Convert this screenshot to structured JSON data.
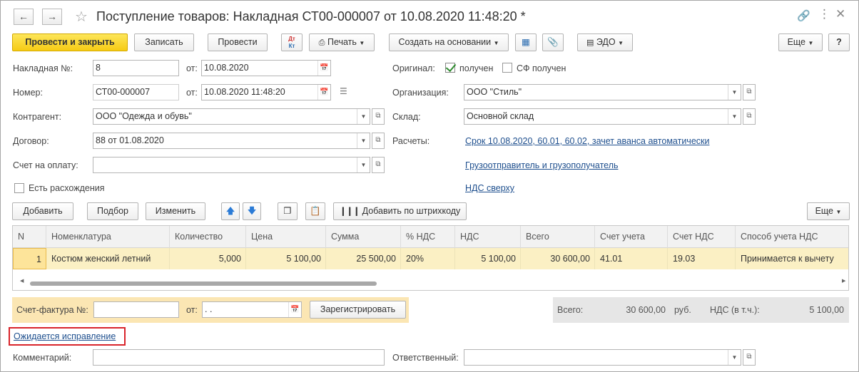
{
  "window": {
    "title": "Поступление товаров: Накладная СТ00-000007 от 10.08.2020 11:48:20 *"
  },
  "toolbar": {
    "post_close": "Провести и закрыть",
    "save": "Записать",
    "post": "Провести",
    "dtkt": "Дт Кт",
    "print": "Печать",
    "create_based": "Создать на основании",
    "edo": "ЭДО",
    "more": "Еще",
    "help": "?"
  },
  "form": {
    "invoice_label": "Накладная №:",
    "invoice_value": "8",
    "from_label": "от:",
    "invoice_date": "10.08.2020",
    "number_label": "Номер:",
    "number_value": "СТ00-000007",
    "number_date": "10.08.2020 11:48:20",
    "counterparty_label": "Контрагент:",
    "counterparty_value": "ООО \"Одежда и обувь\"",
    "contract_label": "Договор:",
    "contract_value": "88 от 01.08.2020",
    "payment_label": "Счет на оплату:",
    "payment_value": "",
    "discrepancy_label": "Есть расхождения",
    "original_label": "Оригинал:",
    "received_label": "получен",
    "sf_received_label": "СФ получен",
    "organization_label": "Организация:",
    "organization_value": "ООО \"Стиль\"",
    "warehouse_label": "Склад:",
    "warehouse_value": "Основной склад",
    "settlements_label": "Расчеты:",
    "settlements_link": "Срок 10.08.2020, 60.01, 60.02, зачет аванса автоматически",
    "shipper_link": "Грузоотправитель и грузополучатель",
    "vat_link": "НДС сверху"
  },
  "table_toolbar": {
    "add": "Добавить",
    "select": "Подбор",
    "edit": "Изменить",
    "barcode": "Добавить по штрихкоду",
    "more": "Еще"
  },
  "table": {
    "columns": [
      "N",
      "Номенклатура",
      "Количество",
      "Цена",
      "Сумма",
      "% НДС",
      "НДС",
      "Всего",
      "Счет учета",
      "Счет НДС",
      "Способ учета НДС"
    ],
    "rows": [
      [
        "1",
        "Костюм женский летний",
        "5,000",
        "5 100,00",
        "25 500,00",
        "20%",
        "5 100,00",
        "30 600,00",
        "41.01",
        "19.03",
        "Принимается к вычету"
      ]
    ]
  },
  "invoice_bar": {
    "label": "Счет-фактура №:",
    "number": "",
    "from_label": "от:",
    "date": " .  .",
    "register": "Зарегистрировать"
  },
  "totals": {
    "total_label": "Всего:",
    "total_value": "30 600,00",
    "currency": "руб.",
    "vat_label": "НДС (в т.ч.):",
    "vat_value": "5 100,00"
  },
  "footer": {
    "correction_link": "Ожидается исправление",
    "comment_label": "Комментарий:",
    "comment_value": "",
    "responsible_label": "Ответственный:",
    "responsible_value": ""
  },
  "colors": {
    "primary_button": "#f6cb14",
    "link": "#1e4f8e",
    "selected_row": "#fbf0c4",
    "highlight_box": "#d9242b"
  }
}
